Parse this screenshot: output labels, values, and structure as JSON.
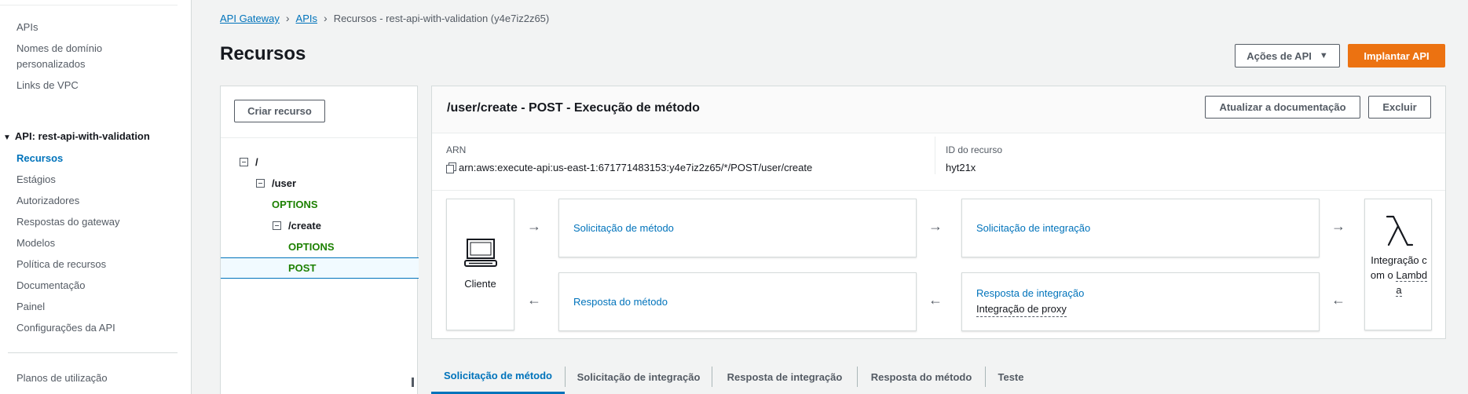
{
  "sidebar": {
    "top_items": [
      {
        "label": "APIs"
      },
      {
        "label": "Nomes de domínio personalizados"
      },
      {
        "label": "Links de VPC"
      }
    ],
    "api_label": "API: rest-api-with-validation",
    "api_items": [
      {
        "label": "Recursos",
        "active": true
      },
      {
        "label": "Estágios"
      },
      {
        "label": "Autorizadores"
      },
      {
        "label": "Respostas do gateway"
      },
      {
        "label": "Modelos"
      },
      {
        "label": "Política de recursos"
      },
      {
        "label": "Documentação"
      },
      {
        "label": "Painel"
      },
      {
        "label": "Configurações da API"
      }
    ],
    "bottom_items": [
      {
        "label": "Planos de utilização"
      }
    ]
  },
  "breadcrumb": {
    "items": [
      "API Gateway",
      "APIs"
    ],
    "current": "Recursos - rest-api-with-validation (y4e7iz2z65)"
  },
  "page": {
    "title": "Recursos",
    "actions_label": "Ações de API",
    "deploy_label": "Implantar API"
  },
  "tree": {
    "create_label": "Criar recurso",
    "nodes": {
      "root": "/",
      "user": "/user",
      "user_options": "OPTIONS",
      "create": "/create",
      "create_options": "OPTIONS",
      "create_post": "POST"
    },
    "selected": "POST"
  },
  "method": {
    "title": "/user/create - POST - Execução de método",
    "update_docs_label": "Atualizar a documentação",
    "delete_label": "Excluir",
    "arn_label": "ARN",
    "arn_value": "arn:aws:execute-api:us-east-1:671771483153:y4e7iz2z65/*/POST/user/create",
    "resource_id_label": "ID do recurso",
    "resource_id_value": "hyt21x",
    "flow": {
      "client": "Cliente",
      "method_request": "Solicitação de método",
      "integration_request": "Solicitação de integração",
      "integration_response": "Resposta de integração",
      "integration_response_sub": "Integração de proxy",
      "method_response": "Resposta do método",
      "lambda_line1": "Integração com o ",
      "lambda_line2": "Lambda",
      "arrow_right": "→",
      "arrow_left": "←"
    }
  },
  "tabs": [
    {
      "label": "Solicitação de método",
      "active": true
    },
    {
      "label": "Solicitação de integração"
    },
    {
      "label": "Resposta de integração"
    },
    {
      "label": "Resposta do método"
    },
    {
      "label": "Teste"
    }
  ],
  "colors": {
    "accent": "#0073bb",
    "primary_button": "#ec7211",
    "method_green": "#1d8102"
  }
}
